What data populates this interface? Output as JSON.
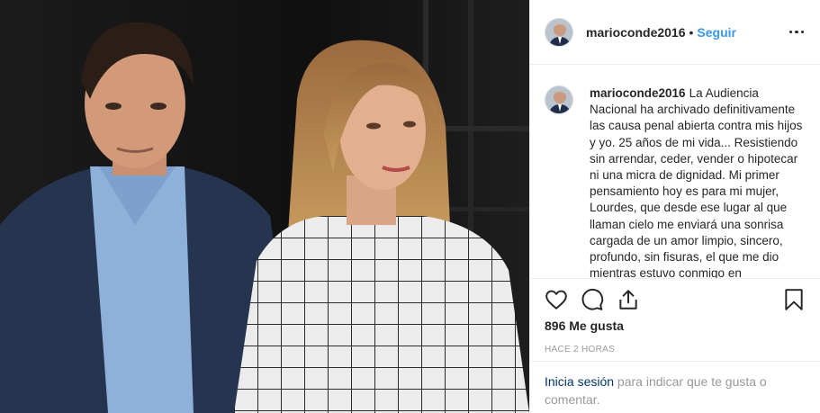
{
  "post": {
    "username": "marioconde2016",
    "separator": "•",
    "follow_label": "Seguir",
    "caption": "La Audiencia Nacional ha archivado definitivamente las causa penal abierta contra mis hijos y yo. 25 años de mi vida... Resistiendo sin arrendar, ceder, vender o hipotecar ni una micra de dignidad. Mi primer pensamiento hoy es para mi mujer, Lourdes, que desde ese lugar al que llaman cielo me enviará una sonrisa cargada de un amor limpio, sincero, profundo, sin fisuras, el que me dio mientras estuvo conmigo en",
    "likes_text": "896 Me gusta",
    "time_text": "HACE 2 HORAS"
  },
  "login": {
    "link_text": "Inicia sesión",
    "rest_text": " para indicar que te gusta o comentar."
  },
  "icons": {
    "more": "more-options-icon",
    "like": "heart-icon",
    "comment": "comment-icon",
    "share": "share-icon",
    "save": "bookmark-icon"
  },
  "colors": {
    "accent": "#3897f0",
    "link": "#003569",
    "muted": "#999999",
    "border": "#efefef"
  }
}
